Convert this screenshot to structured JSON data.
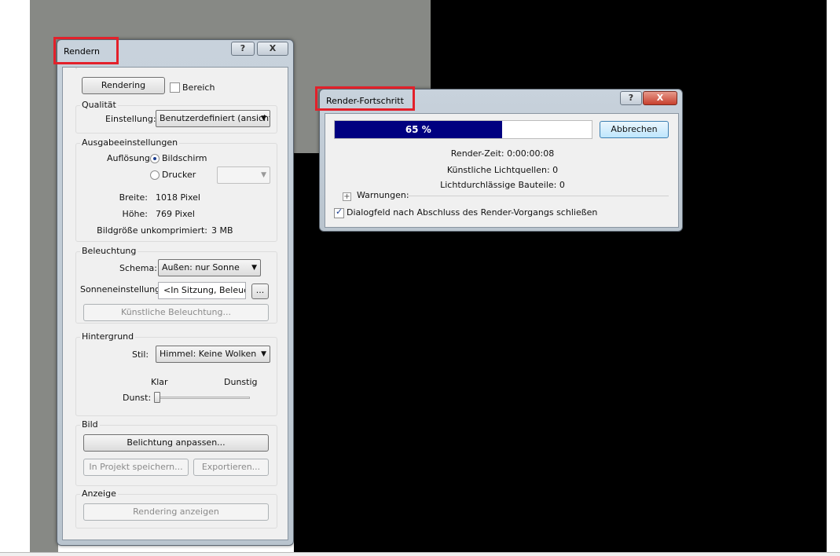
{
  "render_dialog": {
    "title": "Rendern",
    "help_label": "?",
    "close_label": "X",
    "rendering_button": "Rendering",
    "bereich_label": "Bereich",
    "bereich_checked": false,
    "quality": {
      "group": "Qualität",
      "setting_label": "Einstellung:",
      "setting_value": "Benutzerdefiniert (ansicht"
    },
    "output": {
      "group": "Ausgabeeinstellungen",
      "resolution_label": "Auflösung:",
      "option_screen": "Bildschirm",
      "option_printer": "Drucker",
      "width_label": "Breite:",
      "width_value": "1018 Pixel",
      "height_label": "Höhe:",
      "height_value": "769 Pixel",
      "size_label": "Bildgröße unkomprimiert:",
      "size_value": "3 MB"
    },
    "lighting": {
      "group": "Beleuchtung",
      "scheme_label": "Schema:",
      "scheme_value": "Außen: nur Sonne",
      "sun_label": "Sonneneinstellung:",
      "sun_value": "<In Sitzung, Beleucht",
      "browse_label": "...",
      "artificial_button": "Künstliche Beleuchtung..."
    },
    "background": {
      "group": "Hintergrund",
      "style_label": "Stil:",
      "style_value": "Himmel: Keine Wolken",
      "clear_label": "Klar",
      "haze_label": "Dunstig",
      "haze_slider_label": "Dunst:",
      "haze_level": 0
    },
    "image": {
      "group": "Bild",
      "exposure_button": "Belichtung anpassen...",
      "save_button": "In Projekt speichern...",
      "export_button": "Exportieren..."
    },
    "display": {
      "group": "Anzeige",
      "show_button": "Rendering anzeigen"
    }
  },
  "progress_dialog": {
    "title": "Render-Fortschritt",
    "help_label": "?",
    "close_label": "X",
    "progress_percent": 65,
    "progress_text": "65 %",
    "cancel_button": "Abbrechen",
    "render_time": "Render-Zeit: 0:00:00:08",
    "artificial_lights": "Künstliche Lichtquellen: 0",
    "translucent_parts": "Lichtdurchlässige Bauteile: 0",
    "warnings_label": "Warnungen:",
    "close_on_finish_label": "Dialogfeld nach Abschluss des Render-Vorgangs schließen",
    "close_on_finish_checked": true
  },
  "colors": {
    "progress_fill": "#000080",
    "highlight_box": "#e3202a",
    "close_button": "#c7402d"
  }
}
